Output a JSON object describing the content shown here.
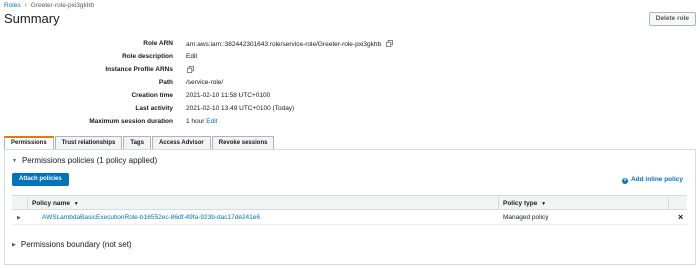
{
  "breadcrumb": {
    "parent": "Roles",
    "current": "Greeter-role-pxi3gkhb"
  },
  "page": {
    "title": "Summary",
    "delete_label": "Delete role"
  },
  "summary": {
    "role_arn_label": "Role ARN",
    "role_arn_value": "arn:aws:iam::382442301643:role/service-role/Greeter-role-pxi3gkhb",
    "role_description_label": "Role description",
    "role_description_edit": "Edit",
    "instance_profile_label": "Instance Profile ARNs",
    "path_label": "Path",
    "path_value": "/service-role/",
    "creation_time_label": "Creation time",
    "creation_time_value": "2021-02-10 11:58 UTC+0100",
    "last_activity_label": "Last activity",
    "last_activity_value": "2021-02-10 13:49 UTC+0100 (Today)",
    "max_session_label": "Maximum session duration",
    "max_session_value": "1 hour",
    "max_session_edit": "Edit"
  },
  "tabs": [
    {
      "label": "Permissions",
      "active": true
    },
    {
      "label": "Trust relationships",
      "active": false
    },
    {
      "label": "Tags",
      "active": false
    },
    {
      "label": "Access Advisor",
      "active": false
    },
    {
      "label": "Revoke sessions",
      "active": false
    }
  ],
  "permissions": {
    "policies_title": "Permissions policies (1 policy applied)",
    "attach_label": "Attach policies",
    "add_inline_label": "Add inline policy",
    "columns": {
      "name": "Policy name",
      "type": "Policy type"
    },
    "rows": [
      {
        "name": "AWSLambdaBasicExecutionRole-b16552ec-86df-49fa-923b-dac17de241e6",
        "type": "Managed policy"
      }
    ],
    "boundary_title": "Permissions boundary (not set)"
  },
  "icons": {
    "copy": "copy-icon",
    "caret": "caret-down-icon",
    "add": "plus-circle-icon",
    "remove": "close-icon",
    "expand": "caret-right-icon"
  },
  "colors": {
    "link": "#0073bb",
    "primary_button": "#0073bb",
    "active_tab": "#ec7211"
  }
}
